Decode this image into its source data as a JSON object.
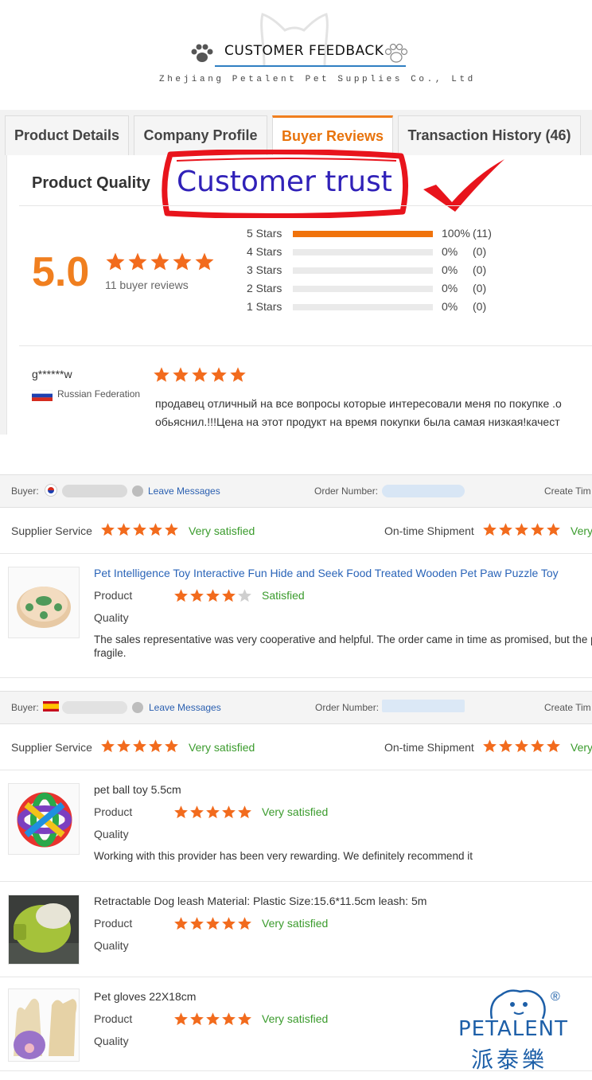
{
  "banner": {
    "title": "CUSTOMER FEEDBACK",
    "subtitle": "Zhejiang Petalent Pet Supplies Co., Ltd"
  },
  "tabs": [
    {
      "label": "Product Details",
      "active": false
    },
    {
      "label": "Company Profile",
      "active": false
    },
    {
      "label": "Buyer Reviews",
      "active": true
    },
    {
      "label": "Transaction History (46)",
      "active": false
    }
  ],
  "summary": {
    "section_label": "Product Quality",
    "overlay_text": "Customer trust",
    "score": "5.0",
    "reviews_label": "11 buyer reviews",
    "rating_stars": 5,
    "breakdown": [
      {
        "label": "5 Stars",
        "percent": "100%",
        "count": "(11)",
        "fill": 1.0
      },
      {
        "label": "4 Stars",
        "percent": "0%",
        "count": "(0)",
        "fill": 0
      },
      {
        "label": "3 Stars",
        "percent": "0%",
        "count": "(0)",
        "fill": 0
      },
      {
        "label": "2 Stars",
        "percent": "0%",
        "count": "(0)",
        "fill": 0
      },
      {
        "label": "1 Stars",
        "percent": "0%",
        "count": "(0)",
        "fill": 0
      }
    ]
  },
  "review": {
    "user": "g******w",
    "country": "Russian Federation",
    "stars": 5,
    "text_line1": "продавец отличный на все вопросы которые интересовали меня по покупке .о",
    "text_line2": "обьяснил.!!!Цена на этот продукт на время покупки была самая низкая!качест"
  },
  "orders": [
    {
      "buyer_label": "Buyer:",
      "leave_messages": "Leave Messages",
      "order_number_label": "Order Number:",
      "create_time_label": "Create Tim",
      "supplier_service_label": "Supplier Service",
      "supplier_service_rating": "Very satisfied",
      "shipment_label": "On-time Shipment",
      "shipment_rating": "Very",
      "products": [
        {
          "title": "Pet Intelligence Toy Interactive Fun Hide and Seek Food Treated Wooden Pet Paw Puzzle Toy",
          "quality_label_1": "Product",
          "quality_label_2": "Quality",
          "stars": 4,
          "rating": "Satisfied",
          "comment_1": "The sales representative was very cooperative and helpful. The order came in time as promised, but the p",
          "comment_2": "fragile."
        }
      ]
    },
    {
      "buyer_label": "Buyer:",
      "leave_messages": "Leave Messages",
      "order_number_label": "Order Number:",
      "create_time_label": "Create Tim",
      "supplier_service_label": "Supplier Service",
      "supplier_service_rating": "Very satisfied",
      "shipment_label": "On-time Shipment",
      "shipment_rating": "Very",
      "products": [
        {
          "title": "pet ball toy 5.5cm",
          "quality_label_1": "Product",
          "quality_label_2": "Quality",
          "stars": 5,
          "rating": "Very satisfied",
          "comment_1": "Working with this provider has been very rewarding. We definitely recommend it"
        },
        {
          "title": "Retractable Dog leash Material: Plastic Size:15.6*11.5cm leash: 5m",
          "quality_label_1": "Product",
          "quality_label_2": "Quality",
          "stars": 5,
          "rating": "Very satisfied"
        },
        {
          "title": "Pet gloves 22X18cm",
          "quality_label_1": "Product",
          "quality_label_2": "Quality",
          "stars": 5,
          "rating": "Very satisfied"
        }
      ]
    }
  ],
  "logo": {
    "text": "PETALENT",
    "chinese": "派泰樂",
    "reg_mark": "®"
  },
  "colors": {
    "accent_orange": "#f07f1f",
    "star_orange": "#f26b1d",
    "link_blue": "#2a64b8",
    "satisfied_green": "#3a9b2c",
    "trust_blue": "#3021b8",
    "trust_red": "#e8141c"
  }
}
